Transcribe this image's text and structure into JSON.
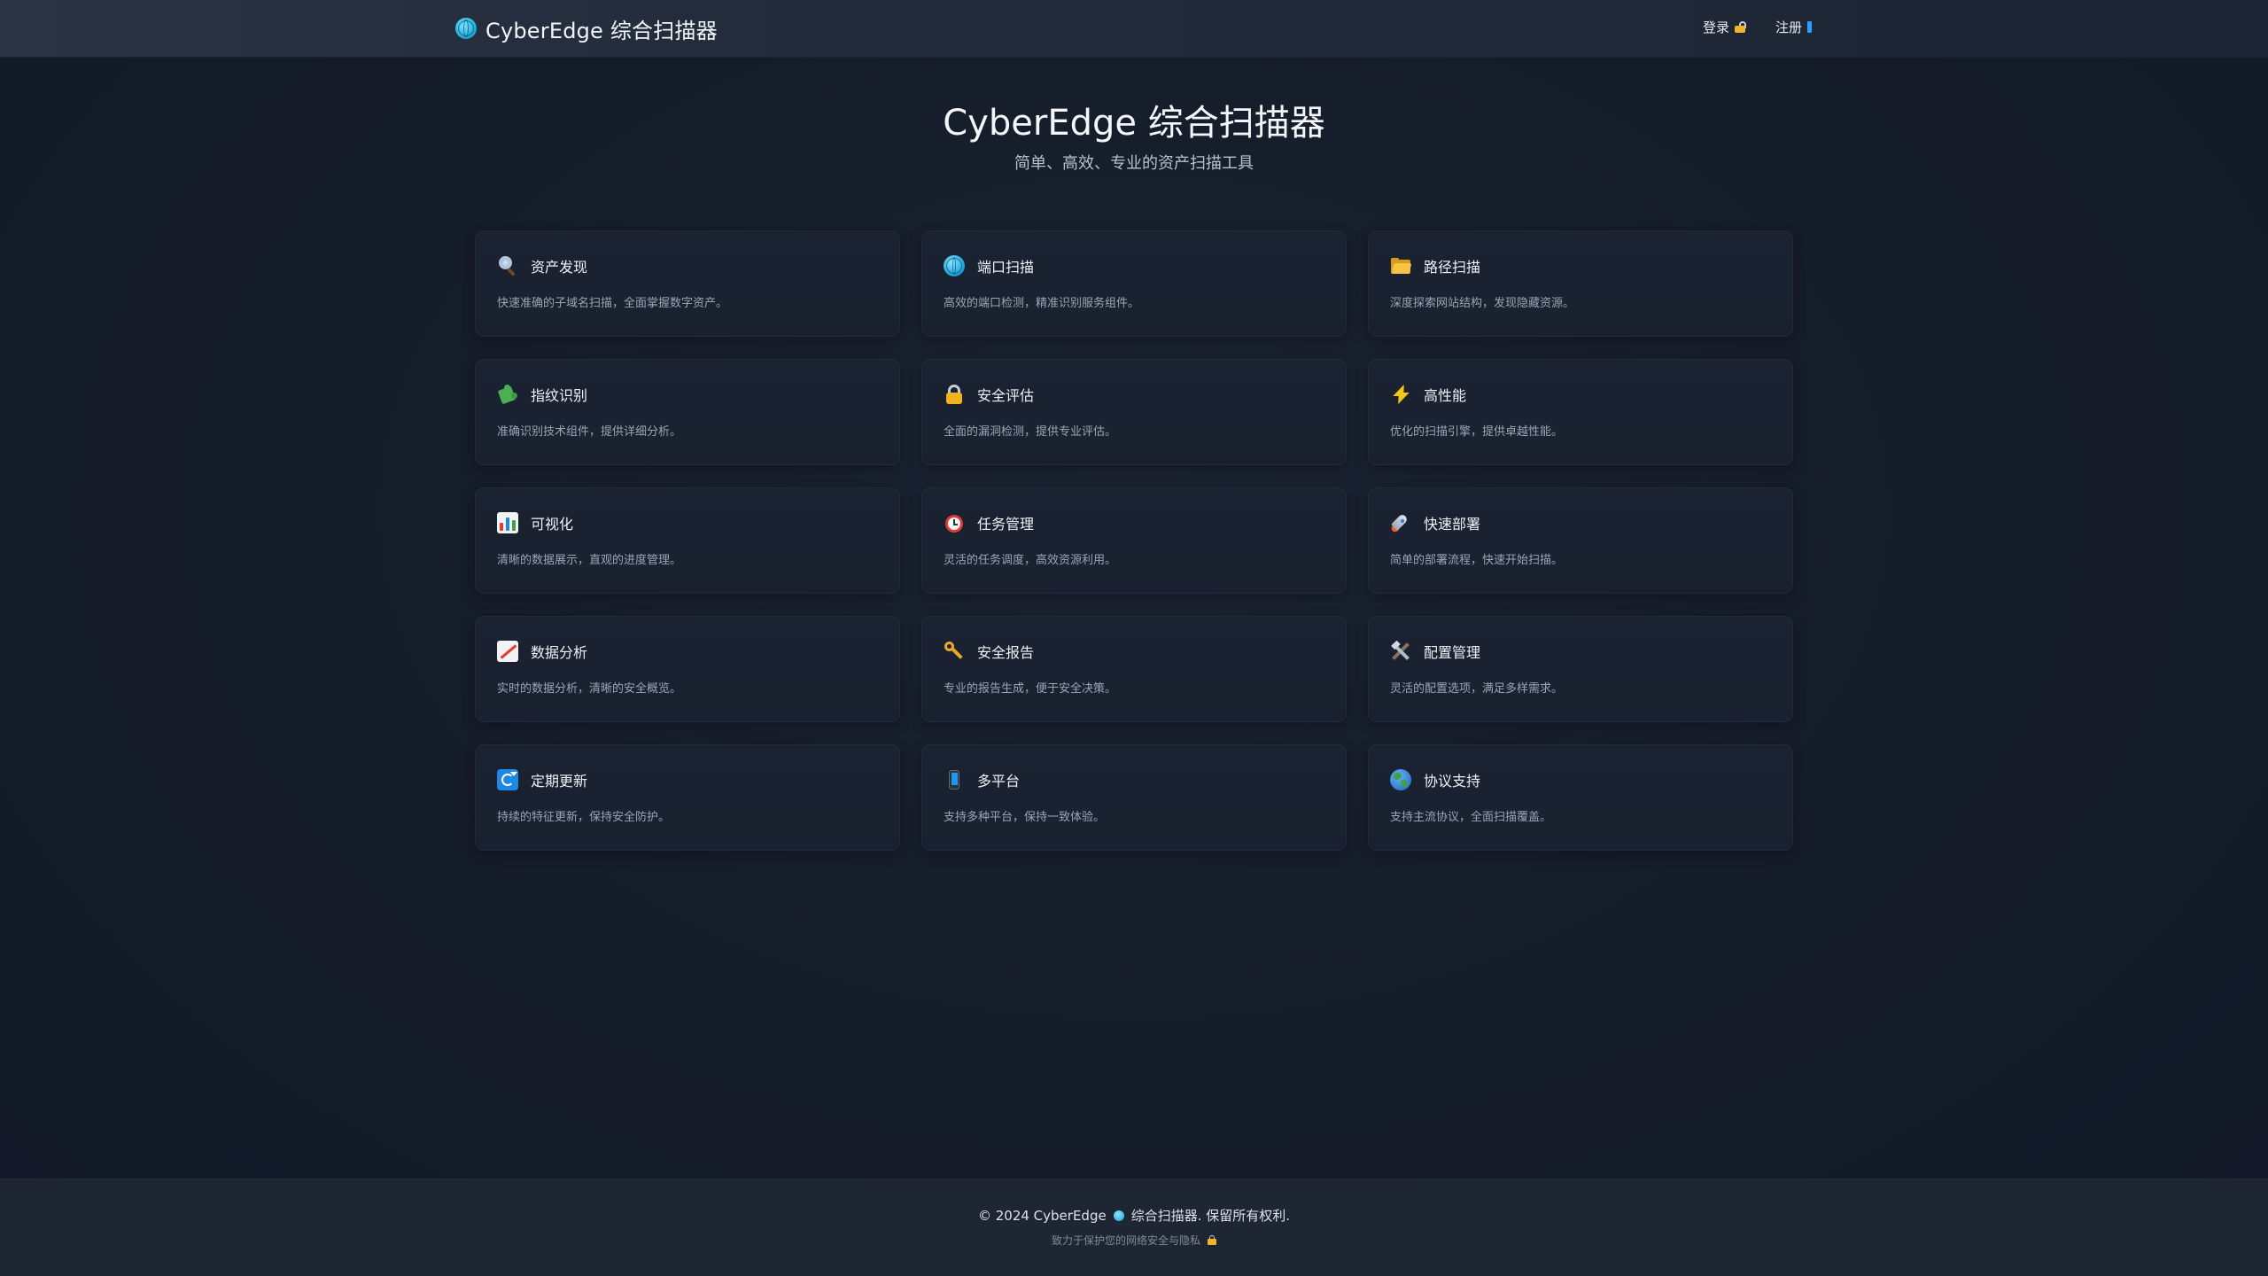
{
  "header": {
    "brand_icon": "globe-icon",
    "brand_text": "CyberEdge 综合扫描器",
    "nav": [
      {
        "label": "登录",
        "icon": "lock-icon"
      },
      {
        "label": "注册",
        "icon": "pen-icon"
      }
    ]
  },
  "hero": {
    "title": "CyberEdge 综合扫描器",
    "subtitle": "简单、高效、专业的资产扫描工具"
  },
  "features": [
    {
      "icon": "magnifier-icon",
      "title": "资产发现",
      "desc": "快速准确的子域名扫描，全面掌握数字资产。"
    },
    {
      "icon": "globe-icon",
      "title": "端口扫描",
      "desc": "高效的端口检测，精准识别服务组件。"
    },
    {
      "icon": "folder-icon",
      "title": "路径扫描",
      "desc": "深度探索网站结构，发现隐藏资源。"
    },
    {
      "icon": "puzzle-icon",
      "title": "指纹识别",
      "desc": "准确识别技术组件，提供详细分析。"
    },
    {
      "icon": "lock-icon",
      "title": "安全评估",
      "desc": "全面的漏洞检测，提供专业评估。"
    },
    {
      "icon": "lightning-icon",
      "title": "高性能",
      "desc": "优化的扫描引擎，提供卓越性能。"
    },
    {
      "icon": "bar-chart-icon",
      "title": "可视化",
      "desc": "清晰的数据展示，直观的进度管理。"
    },
    {
      "icon": "alarm-clock-icon",
      "title": "任务管理",
      "desc": "灵活的任务调度，高效资源利用。"
    },
    {
      "icon": "rocket-icon",
      "title": "快速部署",
      "desc": "简单的部署流程，快速开始扫描。"
    },
    {
      "icon": "trend-chart-icon",
      "title": "数据分析",
      "desc": "实时的数据分析，清晰的安全概览。"
    },
    {
      "icon": "key-icon",
      "title": "安全报告",
      "desc": "专业的报告生成，便于安全决策。"
    },
    {
      "icon": "tools-icon",
      "title": "配置管理",
      "desc": "灵活的配置选项，满足多样需求。"
    },
    {
      "icon": "refresh-icon",
      "title": "定期更新",
      "desc": "持续的特征更新，保持安全防护。"
    },
    {
      "icon": "mobile-phone-icon",
      "title": "多平台",
      "desc": "支持多种平台，保持一致体验。"
    },
    {
      "icon": "earth-icon",
      "title": "协议支持",
      "desc": "支持主流协议，全面扫描覆盖。"
    }
  ],
  "footer": {
    "copyright_pre": "© 2024 CyberEdge",
    "copyright_post": "综合扫描器. 保留所有权利.",
    "tagline": "致力于保护您的网络安全与隐私"
  },
  "colors": {
    "background": "#141b28",
    "card": "#1b2332",
    "header": "#2b3445",
    "footer": "#1e2633",
    "accent": "#22b0e0"
  }
}
